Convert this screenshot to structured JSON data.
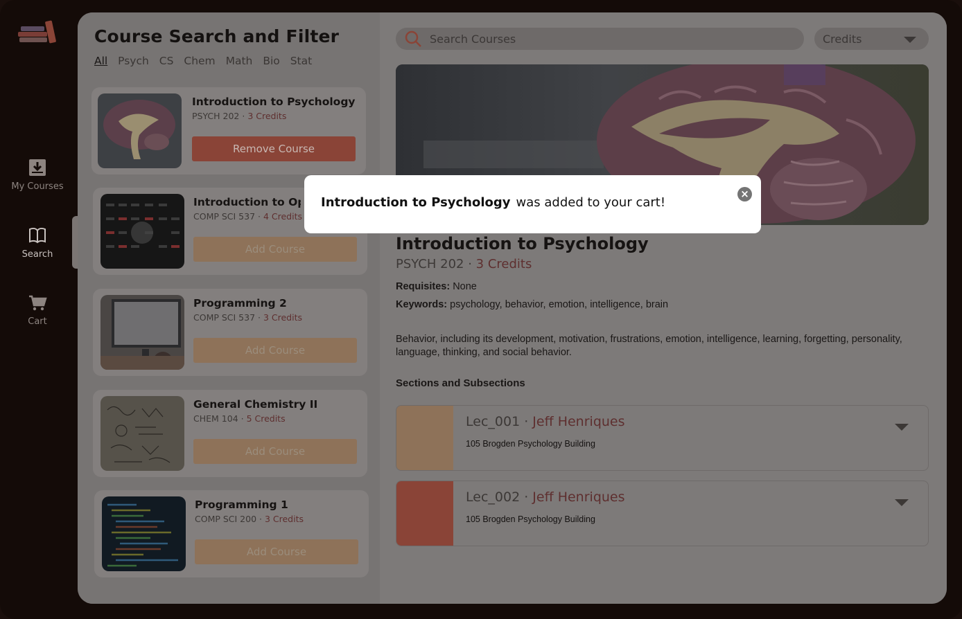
{
  "sidebar": {
    "items": [
      {
        "label": "My Courses",
        "icon": "download-box-icon"
      },
      {
        "label": "Search",
        "icon": "open-book-icon",
        "active": true
      },
      {
        "label": "Cart",
        "icon": "cart-icon"
      }
    ]
  },
  "list": {
    "title": "Course Search and Filter",
    "filters": [
      "All",
      "Psych",
      "CS",
      "Chem",
      "Math",
      "Bio",
      "Stat"
    ],
    "selected_filter": "All",
    "courses": [
      {
        "title": "Introduction to Psychology",
        "code": "PSYCH 202 · ",
        "credits": "3 Credits",
        "button": "Remove Course"
      },
      {
        "title": "Introduction to Operating Systems",
        "code": "COMP SCI 537 · ",
        "credits": "4 Credits",
        "button": "Add Course"
      },
      {
        "title": "Programming 2",
        "code": "COMP SCI 537 · ",
        "credits": "3 Credits",
        "button": "Add Course"
      },
      {
        "title": "General Chemistry II",
        "code": "CHEM 104 · ",
        "credits": "5 Credits",
        "button": "Add Course"
      },
      {
        "title": "Programming 1",
        "code": "COMP SCI 200 · ",
        "credits": "3 Credits",
        "button": "Add Course"
      }
    ]
  },
  "search": {
    "placeholder": "Search Courses",
    "credits_label": "Credits"
  },
  "detail": {
    "title": "Introduction to Psychology",
    "code": "PSYCH 202 · ",
    "credits": "3 Credits",
    "requisites_label": "Requisites:",
    "requisites": " None",
    "keywords_label": "Keywords:",
    "keywords": " psychology, behavior, emotion, intelligence, brain",
    "description": "Behavior, including its development, motivation, frustrations, emotion, intelligence, learning, forgetting, personality, language, thinking, and social behavior.",
    "sections_heading": "Sections and Subsections",
    "sections": [
      {
        "name": "Lec_001 · ",
        "instructor": "Jeff Henriques",
        "location": "105 Brogden Psychology Building",
        "color": "#8e7259"
      },
      {
        "name": "Lec_002 · ",
        "instructor": "Jeff Henriques",
        "location": "105 Brogden Psychology Building",
        "color": "#8a4437"
      }
    ]
  },
  "toast": {
    "course": "Introduction to Psychology",
    "message": "was added to your cart!",
    "close_icon": "close-circle-icon"
  }
}
